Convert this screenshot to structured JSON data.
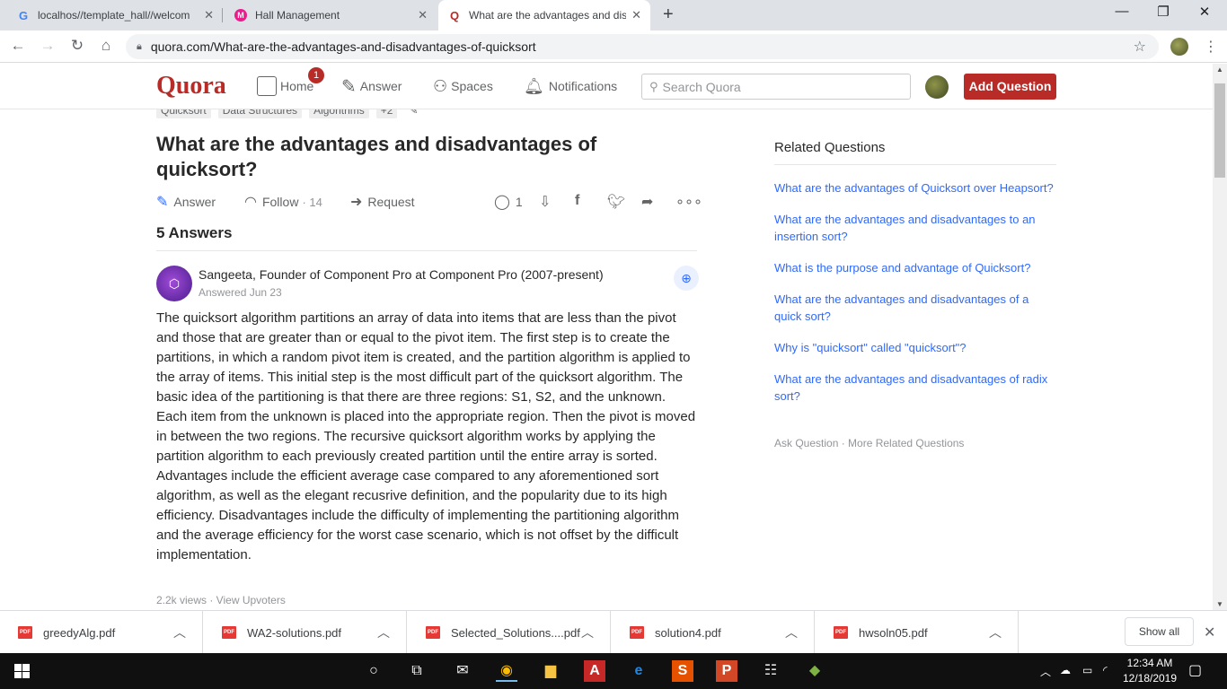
{
  "browser": {
    "tabs": [
      {
        "title": "localhos//template_hall//welcom",
        "icon": "google-icon",
        "active": false
      },
      {
        "title": "Hall Management",
        "icon": "hall-app-icon",
        "active": false
      },
      {
        "title": "What are the advantages and dis",
        "icon": "quora-icon",
        "active": true
      }
    ],
    "url": "quora.com/What-are-the-advantages-and-disadvantages-of-quicksort"
  },
  "quora": {
    "logo": "Quora",
    "nav": {
      "home": "Home",
      "answer": "Answer",
      "spaces": "Spaces",
      "notifications": "Notifications"
    },
    "home_badge": "1",
    "search_placeholder": "Search Quora",
    "add_question": "Add Question",
    "brand_color": "#b92b27"
  },
  "question": {
    "topics": [
      "Quicksort",
      "Data Structures",
      "Algorithms",
      "+2"
    ],
    "title": "What are the advantages and disadvantages of quicksort?",
    "actions": {
      "answer": "Answer",
      "follow": "Follow",
      "follow_count": "· 14",
      "request": "Request",
      "comments": "1"
    },
    "answers_count": "5 Answers"
  },
  "answer": {
    "author": "Sangeeta, Founder of Component Pro at Component Pro (2007-present)",
    "answered": "Answered Jun 23",
    "body": "The quicksort algorithm partitions an array of data into items that are less than the pivot and those that are greater than or equal to the pivot item. The first step is to create the partitions, in which a random pivot item is created, and the partition algorithm is applied to the array of items. This initial step is the most difficult part of the quicksort algorithm. The basic idea of the partitioning is that there are three regions: S1, S2, and the unknown. Each item from the unknown is placed into the appropriate region. Then the pivot is moved in between the two regions. The recursive quicksort algorithm works by applying the partition algorithm to each previously created partition until the entire array is sorted. Advantages include the efficient average case compared to any aforementioned sort algorithm, as well as the elegant recusrive definition, and the popularity due to its high efficiency. Disadvantages include the difficulty of implementing the partitioning algorithm and the average efficiency for the worst case scenario, which is not offset by the difficult implementation.",
    "views": "2.2k views · View Upvoters"
  },
  "sidebar": {
    "title": "Related Questions",
    "items": [
      "What are the advantages of Quicksort over Heapsort?",
      "What are the advantages and disadvantages to an insertion sort?",
      "What is the purpose and advantage of Quicksort?",
      "What are the advantages and disadvantages of a quick sort?",
      "Why is \"quicksort\" called \"quicksort\"?",
      "What are the advantages and disadvantages of radix sort?"
    ],
    "footer": "Ask Question · More Related Questions"
  },
  "downloads": {
    "items": [
      "greedyAlg.pdf",
      "WA2-solutions.pdf",
      "Selected_Solutions....pdf",
      "solution4.pdf",
      "hwsoln05.pdf"
    ],
    "show_all": "Show all"
  },
  "taskbar": {
    "time": "12:34 AM",
    "date": "12/18/2019"
  }
}
